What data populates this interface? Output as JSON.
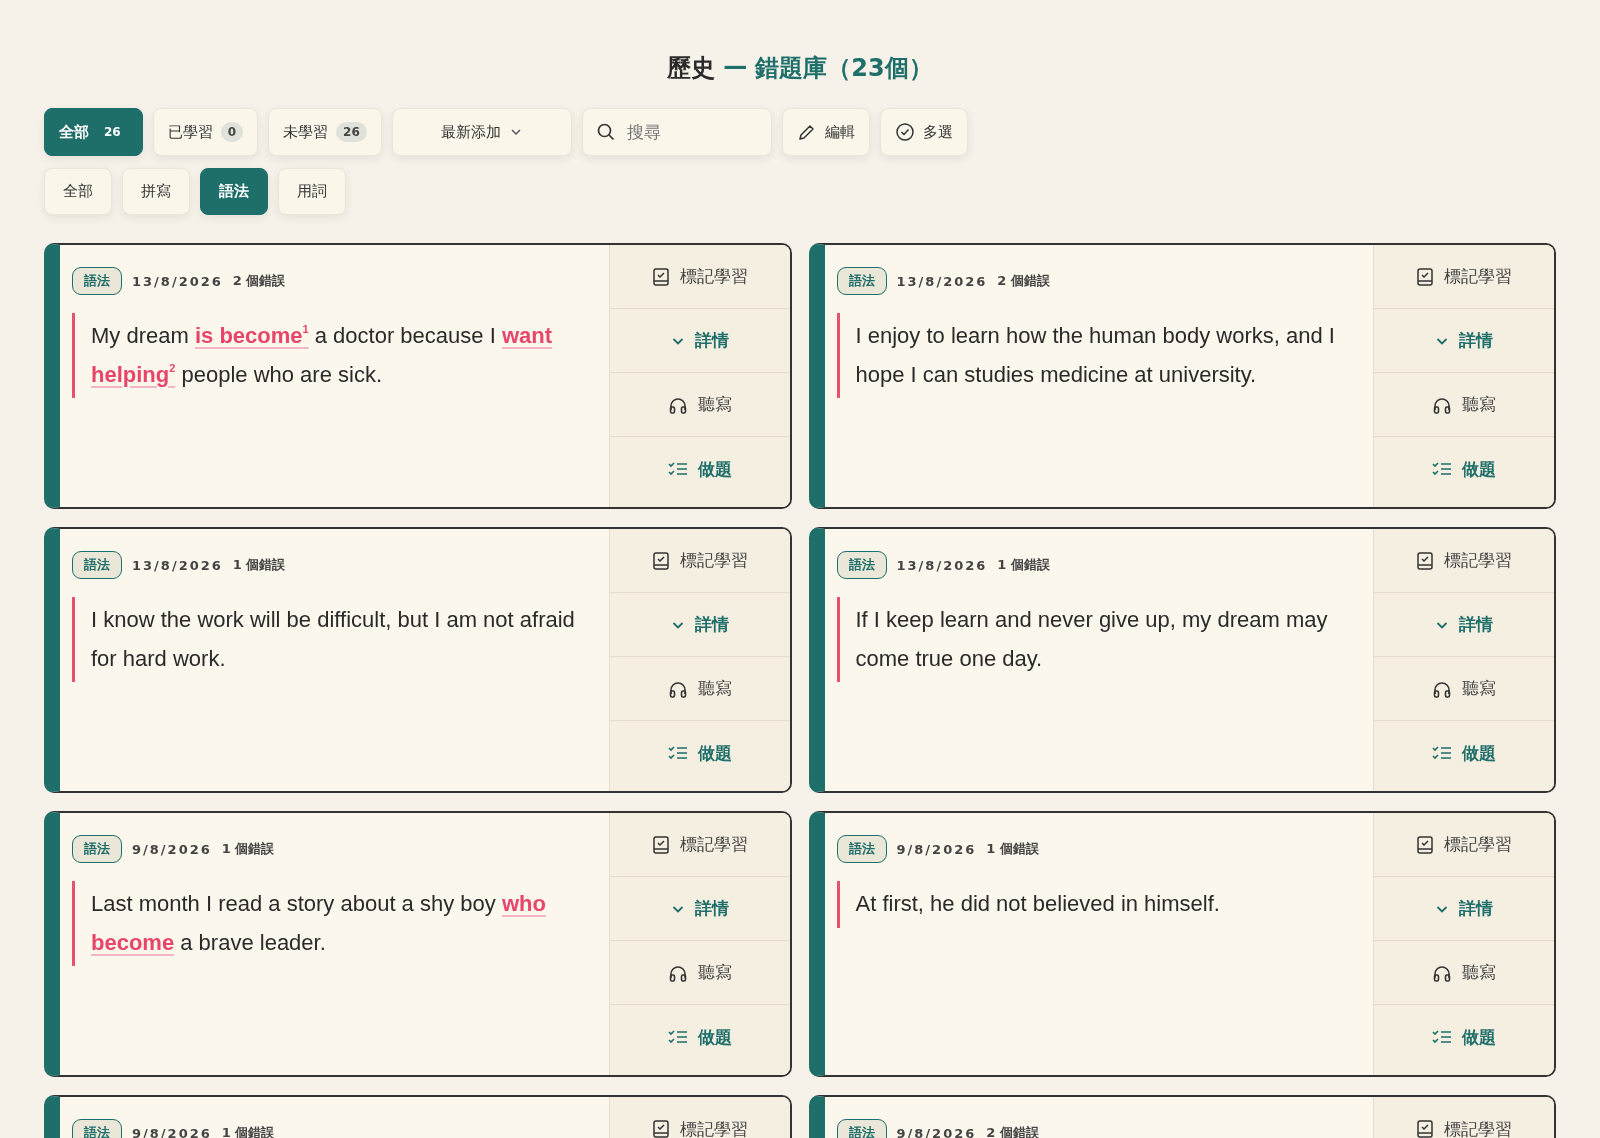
{
  "title": {
    "subject": "歷史",
    "separator": "—",
    "name": "錯題庫（23個）"
  },
  "status_tabs": [
    {
      "label": "全部",
      "count": "26",
      "selected": true
    },
    {
      "label": "已學習",
      "count": "0",
      "selected": false
    },
    {
      "label": "未學習",
      "count": "26",
      "selected": false
    }
  ],
  "sort_dropdown": {
    "value": "最新添加"
  },
  "search": {
    "placeholder": "搜尋"
  },
  "edit_button": {
    "label": "編輯"
  },
  "multi_select_button": {
    "label": "多選"
  },
  "category_tabs": [
    {
      "label": "全部",
      "selected": false
    },
    {
      "label": "拼寫",
      "selected": false
    },
    {
      "label": "語法",
      "selected": true
    },
    {
      "label": "用詞",
      "selected": false
    }
  ],
  "cards": [
    {
      "tag": "語法",
      "date": "13/8/2026",
      "error_count": "2 個錯誤",
      "sentence": [
        {
          "text": "My dream ",
          "error": false
        },
        {
          "text": "is become",
          "error": true,
          "mark": "1"
        },
        {
          "text": " a doctor because I ",
          "error": false
        },
        {
          "text": "want helping",
          "error": true,
          "mark": "2"
        },
        {
          "text": " people who are sick.",
          "error": false
        }
      ],
      "actions": [
        {
          "kind": "mark",
          "label": "標記學習"
        },
        {
          "kind": "details",
          "label": "詳情"
        },
        {
          "kind": "dictation",
          "label": "聽寫"
        },
        {
          "kind": "practice",
          "label": "做題"
        }
      ]
    },
    {
      "tag": "語法",
      "date": "13/8/2026",
      "error_count": "2 個錯誤",
      "sentence": [
        {
          "text": "I enjoy to learn how the human body works, and I hope I can studies medicine at university.",
          "error": false
        }
      ],
      "actions": [
        {
          "kind": "mark",
          "label": "標記學習"
        },
        {
          "kind": "details",
          "label": "詳情"
        },
        {
          "kind": "dictation",
          "label": "聽寫"
        },
        {
          "kind": "practice",
          "label": "做題"
        }
      ]
    },
    {
      "tag": "語法",
      "date": "13/8/2026",
      "error_count": "1 個錯誤",
      "sentence": [
        {
          "text": "I know the work will be difficult, but I am not afraid for hard work.",
          "error": false
        }
      ],
      "actions": [
        {
          "kind": "mark",
          "label": "標記學習"
        },
        {
          "kind": "details",
          "label": "詳情"
        },
        {
          "kind": "dictation",
          "label": "聽寫"
        },
        {
          "kind": "practice",
          "label": "做題"
        }
      ]
    },
    {
      "tag": "語法",
      "date": "13/8/2026",
      "error_count": "1 個錯誤",
      "sentence": [
        {
          "text": "If I keep learn and never give up, my dream may come true one day.",
          "error": false
        }
      ],
      "actions": [
        {
          "kind": "mark",
          "label": "標記學習"
        },
        {
          "kind": "details",
          "label": "詳情"
        },
        {
          "kind": "dictation",
          "label": "聽寫"
        },
        {
          "kind": "practice",
          "label": "做題"
        }
      ]
    },
    {
      "tag": "語法",
      "date": "9/8/2026",
      "error_count": "1 個錯誤",
      "sentence": [
        {
          "text": "Last month I read a story about a shy boy ",
          "error": false
        },
        {
          "text": "who become",
          "error": true
        },
        {
          "text": " a brave leader.",
          "error": false
        }
      ],
      "actions": [
        {
          "kind": "mark",
          "label": "標記學習"
        },
        {
          "kind": "details",
          "label": "詳情"
        },
        {
          "kind": "dictation",
          "label": "聽寫"
        },
        {
          "kind": "practice",
          "label": "做題"
        }
      ]
    },
    {
      "tag": "語法",
      "date": "9/8/2026",
      "error_count": "1 個錯誤",
      "sentence": [
        {
          "text": "At first, he did not believed in himself.",
          "error": false
        }
      ],
      "actions": [
        {
          "kind": "mark",
          "label": "標記學習"
        },
        {
          "kind": "details",
          "label": "詳情"
        },
        {
          "kind": "dictation",
          "label": "聽寫"
        },
        {
          "kind": "practice",
          "label": "做題"
        }
      ]
    },
    {
      "tag": "語法",
      "date": "9/8/2026",
      "error_count": "1 個錯誤",
      "actions": [
        {
          "kind": "mark",
          "label": "標記學習"
        }
      ]
    },
    {
      "tag": "語法",
      "date": "9/8/2026",
      "error_count": "2 個錯誤",
      "actions": [
        {
          "kind": "mark",
          "label": "標記學習"
        }
      ]
    }
  ]
}
